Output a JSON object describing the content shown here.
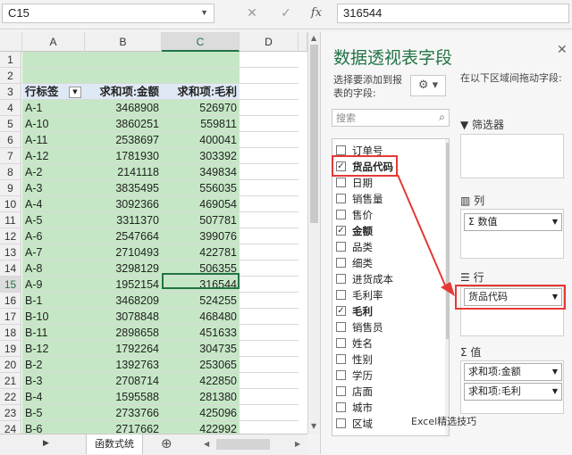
{
  "namebox": {
    "value": "C15"
  },
  "formula": {
    "cancel": "✕",
    "enter": "✓",
    "fx": "fx",
    "value": "316544"
  },
  "grid": {
    "columns": [
      "A",
      "B",
      "C",
      "D"
    ],
    "selected_column": "C",
    "rows": [
      {
        "n": "1",
        "a": "",
        "b": "",
        "c": ""
      },
      {
        "n": "2",
        "a": "",
        "b": "",
        "c": ""
      },
      {
        "n": "3",
        "a": "行标签",
        "b": "求和项:金额",
        "c": "求和项:毛利",
        "header": true
      },
      {
        "n": "4",
        "a": "A-1",
        "b": "3468908",
        "c": "526970"
      },
      {
        "n": "5",
        "a": "A-10",
        "b": "3860251",
        "c": "559811"
      },
      {
        "n": "6",
        "a": "A-11",
        "b": "2538697",
        "c": "400041"
      },
      {
        "n": "7",
        "a": "A-12",
        "b": "1781930",
        "c": "303392"
      },
      {
        "n": "8",
        "a": "A-2",
        "b": "2141118",
        "c": "349834"
      },
      {
        "n": "9",
        "a": "A-3",
        "b": "3835495",
        "c": "556035"
      },
      {
        "n": "10",
        "a": "A-4",
        "b": "3092366",
        "c": "469054"
      },
      {
        "n": "11",
        "a": "A-5",
        "b": "3311370",
        "c": "507781"
      },
      {
        "n": "12",
        "a": "A-6",
        "b": "2547664",
        "c": "399076"
      },
      {
        "n": "13",
        "a": "A-7",
        "b": "2710493",
        "c": "422781"
      },
      {
        "n": "14",
        "a": "A-8",
        "b": "3298129",
        "c": "506355"
      },
      {
        "n": "15",
        "a": "A-9",
        "b": "1952154",
        "c": "316544"
      },
      {
        "n": "16",
        "a": "B-1",
        "b": "3468209",
        "c": "524255"
      },
      {
        "n": "17",
        "a": "B-10",
        "b": "3078848",
        "c": "468480"
      },
      {
        "n": "18",
        "a": "B-11",
        "b": "2898658",
        "c": "451633"
      },
      {
        "n": "19",
        "a": "B-12",
        "b": "1792264",
        "c": "304735"
      },
      {
        "n": "20",
        "a": "B-2",
        "b": "1392763",
        "c": "253065"
      },
      {
        "n": "21",
        "a": "B-3",
        "b": "2708714",
        "c": "422850"
      },
      {
        "n": "22",
        "a": "B-4",
        "b": "1595588",
        "c": "281380"
      },
      {
        "n": "23",
        "a": "B-5",
        "b": "2733766",
        "c": "425096"
      },
      {
        "n": "24",
        "a": "B-6",
        "b": "2717662",
        "c": "422992"
      }
    ],
    "selected_row": "15"
  },
  "tabs": {
    "sheet": "函数式统",
    "add": "⊕"
  },
  "pivot": {
    "title": "数据透视表字段",
    "choose_label": "选择要添加到报表的字段:",
    "search_placeholder": "搜索",
    "fields": [
      {
        "label": "订单号",
        "checked": false,
        "bold": false
      },
      {
        "label": "货品代码",
        "checked": true,
        "bold": true
      },
      {
        "label": "日期",
        "checked": false,
        "bold": false
      },
      {
        "label": "销售量",
        "checked": false,
        "bold": false
      },
      {
        "label": "售价",
        "checked": false,
        "bold": false
      },
      {
        "label": "金额",
        "checked": true,
        "bold": true
      },
      {
        "label": "品类",
        "checked": false,
        "bold": false
      },
      {
        "label": "细类",
        "checked": false,
        "bold": false
      },
      {
        "label": "进货成本",
        "checked": false,
        "bold": false
      },
      {
        "label": "毛利率",
        "checked": false,
        "bold": false
      },
      {
        "label": "毛利",
        "checked": true,
        "bold": true
      },
      {
        "label": "销售员",
        "checked": false,
        "bold": false
      },
      {
        "label": "姓名",
        "checked": false,
        "bold": false
      },
      {
        "label": "性别",
        "checked": false,
        "bold": false
      },
      {
        "label": "学历",
        "checked": false,
        "bold": false
      },
      {
        "label": "店面",
        "checked": false,
        "bold": false
      },
      {
        "label": "城市",
        "checked": false,
        "bold": false
      },
      {
        "label": "区域",
        "checked": false,
        "bold": false
      }
    ],
    "drag_hint": "在以下区域间拖动字段:",
    "filters_label": "筛选器",
    "columns_label": "列",
    "columns_item": "Σ 数值",
    "rows_label": "行",
    "rows_item": "货品代码",
    "values_label": "值",
    "values_items": [
      "求和项:金额",
      "求和项:毛利"
    ]
  },
  "watermark": "Excel精选技巧"
}
